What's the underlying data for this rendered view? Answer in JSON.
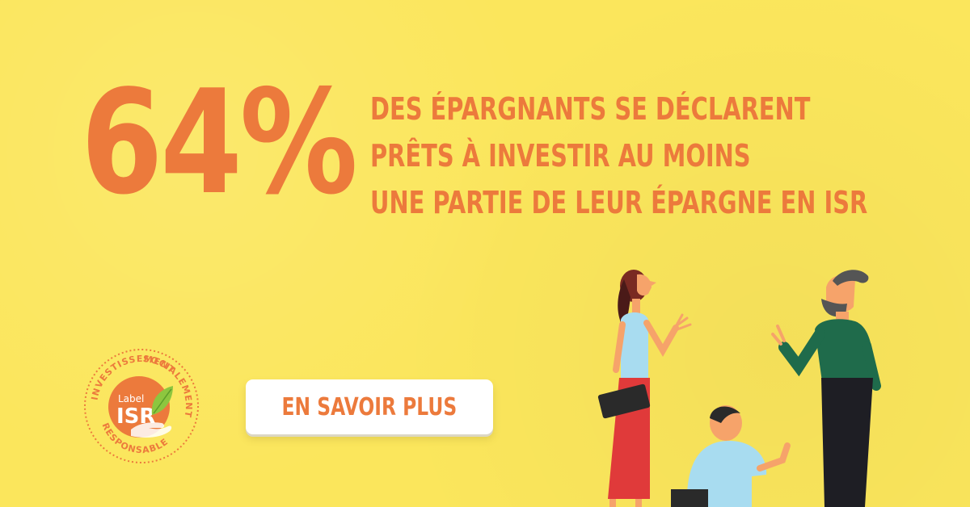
{
  "stat": {
    "value": "64%"
  },
  "headline": {
    "lines": [
      "DES ÉPARGNANTS SE DÉCLARENT",
      "PRÊTS À INVESTIR AU MOINS",
      "UNE PARTIE DE LEUR ÉPARGNE EN ISR"
    ]
  },
  "badge": {
    "label_small": "Label",
    "label_big": "ISR",
    "ring_text_top": "INVESTISSEMENT",
    "ring_text_right": "SOCIALEMENT",
    "ring_text_bottom": "RESPONSABLE",
    "icon": "leaf-hand-icon"
  },
  "cta": {
    "label": "EN SAVOIR PLUS"
  },
  "colors": {
    "background": "#fbe65c",
    "accent": "#ec7a3c",
    "button": "#ffffff"
  }
}
